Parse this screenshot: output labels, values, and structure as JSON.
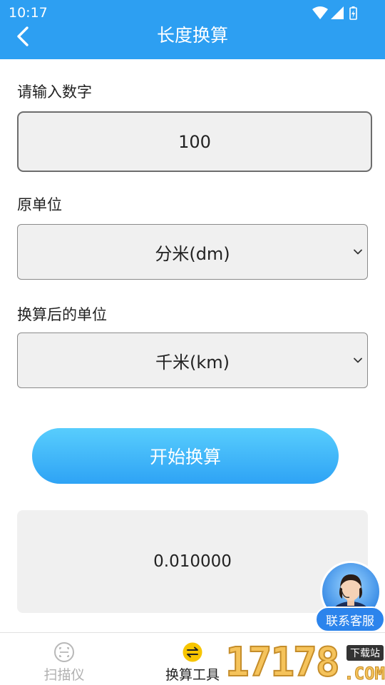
{
  "status_bar": {
    "time": "10:17"
  },
  "header": {
    "title": "长度换算"
  },
  "form": {
    "number_label": "请输入数字",
    "number_value": "100",
    "from_unit_label": "原单位",
    "from_unit_value": "分米(dm)",
    "to_unit_label": "换算后的单位",
    "to_unit_value": "千米(km)",
    "convert_button": "开始换算",
    "result": "0.010000"
  },
  "customer_service": {
    "label": "联系客服"
  },
  "bottom_nav": {
    "items": [
      {
        "label": "扫描仪",
        "icon": "scan-icon",
        "active": false
      },
      {
        "label": "换算工具",
        "icon": "convert-icon",
        "active": true
      }
    ]
  },
  "watermark": {
    "digits": "17178",
    "tag": "下载站",
    "suffix": ".COM"
  },
  "colors": {
    "header_bg": "#2d9ff2",
    "button_gradient_top": "#58cdfd",
    "button_gradient_bottom": "#2ea3f5",
    "field_bg": "#f0f0f0",
    "active_icon": "#f7c500"
  }
}
